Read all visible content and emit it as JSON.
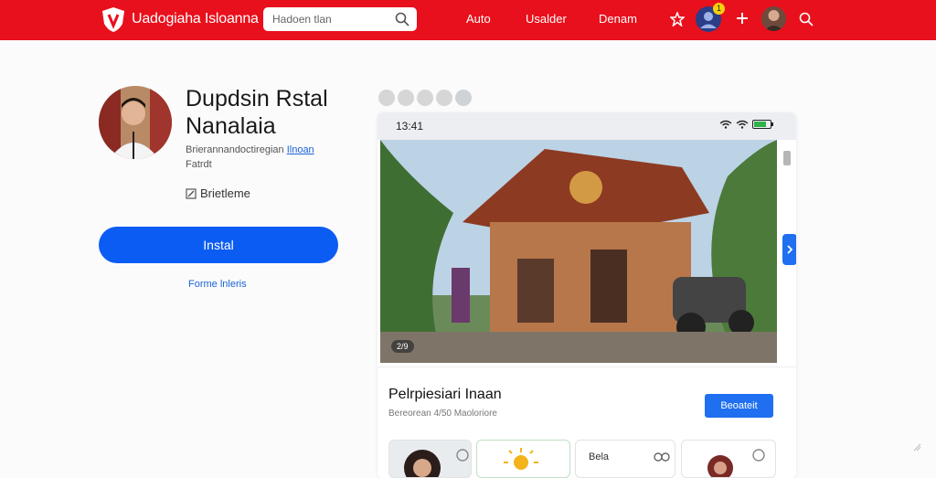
{
  "header": {
    "brand_name": "Uadogiaha Isloanna",
    "search_placeholder": "Hadoen tlan",
    "nav": [
      "Auto",
      "Usalder",
      "Denam"
    ],
    "notification_count": "1",
    "brand_color": "#e8101c"
  },
  "app": {
    "title": "Dupdsin Rstal Nanalaia",
    "developer_text": "Brierannandoctiregian",
    "developer_link": "Ilnoan",
    "developer_sub": "Fatrdt",
    "category": "Brietleme",
    "install_label": "Instal",
    "secondary_link": "Forme lnleris"
  },
  "preview": {
    "time": "13:41",
    "photo_counter": "2/9",
    "item_title": "Pelrpiesiari Inaan",
    "item_sub": "Bereorean 4/50 Maoloriore",
    "item_button": "Beoateit",
    "thumbs": [
      {
        "label": ""
      },
      {
        "label": ""
      },
      {
        "label": "Bela"
      },
      {
        "label": ""
      }
    ]
  },
  "colors": {
    "accent": "#0b5cf3",
    "link": "#1a63d6"
  }
}
